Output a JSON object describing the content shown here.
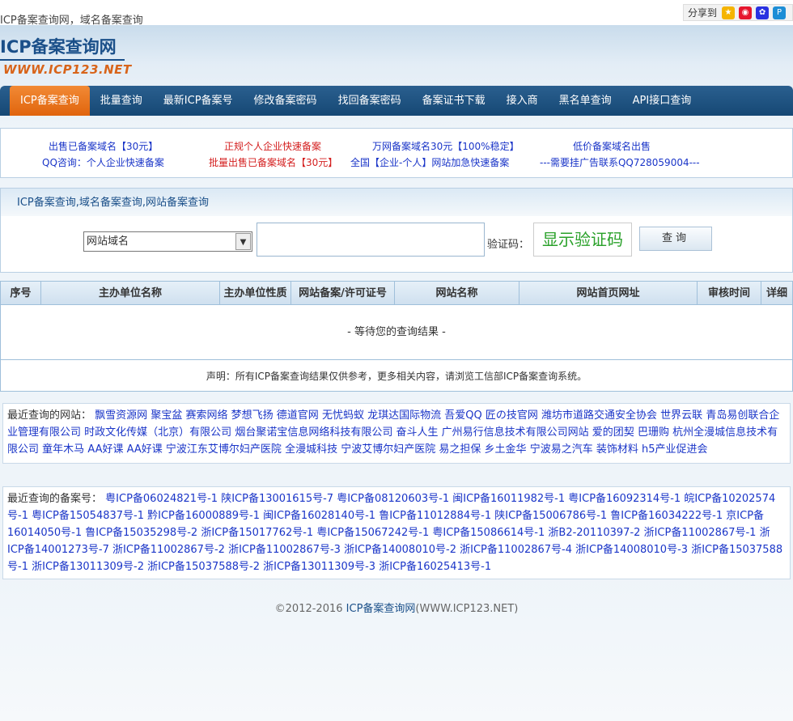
{
  "page_title": "ICP备案查询网，域名备案查询",
  "share": {
    "label": "分享到",
    "icons": [
      "qzone-icon",
      "weibo-icon",
      "baidu-icon",
      "qq-icon"
    ]
  },
  "logo": {
    "main": "ICP备案查询网",
    "sub": "WWW.ICP123.NET"
  },
  "nav": [
    "ICP备案查询",
    "批量查询",
    "最新ICP备案号",
    "修改备案密码",
    "找回备案密码",
    "备案证书下载",
    "接入商",
    "黑名单查询",
    "API接口查询"
  ],
  "ads": [
    {
      "text": "出售已备案域名【30元】",
      "color": "#1a35c8"
    },
    {
      "text": "QQ咨询：个人企业快速备案",
      "color": "#1a35c8"
    },
    {
      "text": "正规个人企业快速备案",
      "color": "#d42020"
    },
    {
      "text": "批量出售已备案域名【30元】",
      "color": "#d42020"
    },
    {
      "text": "万网备案域名30元【100%稳定】",
      "color": "#1a35c8"
    },
    {
      "text": "全国【企业-个人】网站加急快速备案",
      "color": "#1a35c8"
    },
    {
      "text": "低价备案域名出售",
      "color": "#1a35c8"
    },
    {
      "text": "---需要挂广告联系QQ728059004---",
      "color": "#1a35c8"
    }
  ],
  "search": {
    "heading": "ICP备案查询,域名备案查询,网站备案查询",
    "select_value": "网站域名",
    "input_value": "",
    "captcha_label": "验证码：",
    "captcha_text": "显示验证码",
    "query_label": "查询"
  },
  "table": {
    "headers": [
      "序号",
      "主办单位名称",
      "主办单位性质",
      "网站备案/许可证号",
      "网站名称",
      "网站首页网址",
      "审核时间",
      "详细"
    ],
    "empty": "- 等待您的查询结果 -",
    "notice": "声明：所有ICP备案查询结果仅供参考，更多相关内容，请浏览工信部ICP备案查询系统。"
  },
  "recent_sites": {
    "label": "最近查询的网站：",
    "items": [
      "飘雪资源网",
      "聚宝盆",
      "赛索网络",
      "梦想飞扬",
      "德道官网",
      "无忧蚂蚁",
      "龙琪达国际物流",
      "吾爱QQ",
      "匠の技官网",
      "潍坊市道路交通安全协会",
      "世界云联",
      "青岛易创联合企业管理有限公司",
      "时政文化传媒（北京）有限公司",
      "烟台聚诺宝信息网络科技有限公司",
      "奋斗人生",
      "广州易行信息技术有限公司网站",
      "爱的团契",
      "巴珊购",
      "杭州全漫城信息技术有限公司",
      "童年木马",
      "AA好课",
      "AA好课",
      "宁波江东艾博尔妇产医院",
      "全漫城科技",
      "宁波艾博尔妇产医院",
      "易之担保",
      "乡土金华",
      "宁波易之汽车",
      "装饰材料",
      "h5产业促进会"
    ]
  },
  "recent_icp": {
    "label": "最近查询的备案号：",
    "items": [
      "粤ICP备06024821号-1",
      "陕ICP备13001615号-7",
      "粤ICP备08120603号-1",
      "闽ICP备16011982号-1",
      "粤ICP备16092314号-1",
      "皖ICP备10202574号-1",
      "粤ICP备15054837号-1",
      "黔ICP备16000889号-1",
      "闽ICP备16028140号-1",
      "鲁ICP备11012884号-1",
      "陕ICP备15006786号-1",
      "鲁ICP备16034222号-1",
      "京ICP备16014050号-1",
      "鲁ICP备15035298号-2",
      "浙ICP备15017762号-1",
      "粤ICP备15067242号-1",
      "粤ICP备15086614号-1",
      "浙B2-20110397-2",
      "浙ICP备11002867号-1",
      "浙ICP备14001273号-7",
      "浙ICP备11002867号-2",
      "浙ICP备11002867号-3",
      "浙ICP备14008010号-2",
      "浙ICP备11002867号-4",
      "浙ICP备14008010号-3",
      "浙ICP备15037588号-1",
      "浙ICP备13011309号-2",
      "浙ICP备15037588号-2",
      "浙ICP备13011309号-3",
      "浙ICP备16025413号-1"
    ]
  },
  "footer": {
    "copyright": "©2012-2016 ",
    "site": "ICP备案查询网",
    "url": "(WWW.ICP123.NET)"
  }
}
